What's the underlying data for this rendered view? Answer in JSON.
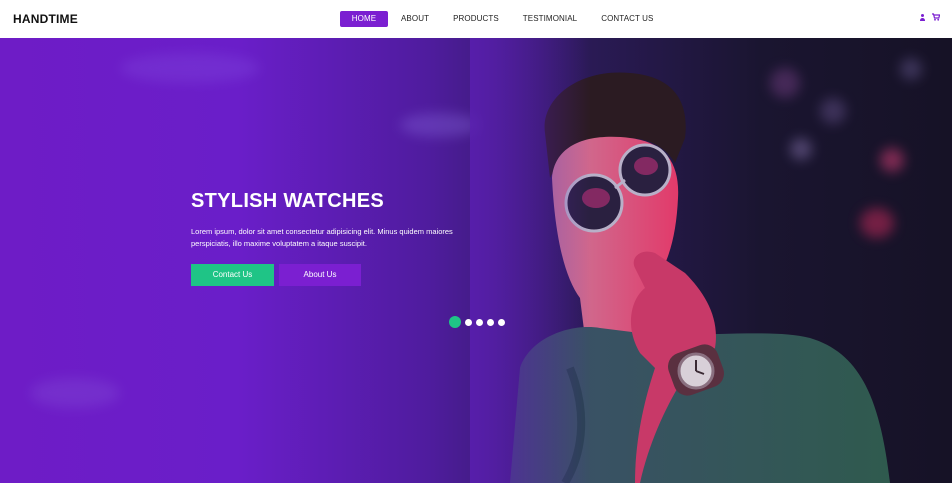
{
  "brand": "HANDTIME",
  "nav": {
    "items": [
      {
        "label": "HOME",
        "active": true
      },
      {
        "label": "ABOUT",
        "active": false
      },
      {
        "label": "PRODUCTS",
        "active": false
      },
      {
        "label": "TESTIMONIAL",
        "active": false
      },
      {
        "label": "CONTACT US",
        "active": false
      }
    ],
    "icons": [
      "user-icon",
      "cart-icon"
    ]
  },
  "hero": {
    "title": "STYLISH WATCHES",
    "description": "Lorem ipsum, dolor sit amet consectetur adipisicing elit. Minus quidem maiores perspiciatis, illo maxime voluptatem a itaque suscipit.",
    "buttons": {
      "contact": "Contact Us",
      "about": "About Us"
    },
    "slider": {
      "total": 5,
      "active": 1
    }
  },
  "colors": {
    "accent": "#7b1fd1",
    "green": "#1fc486"
  }
}
